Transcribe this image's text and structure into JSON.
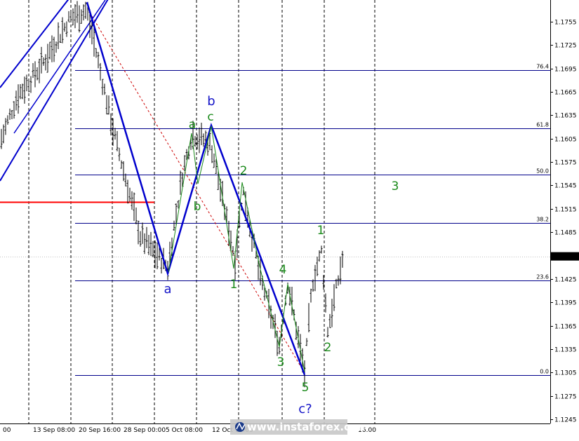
{
  "chart_data": {
    "type": "candlestick",
    "title": "",
    "y_ticks": [
      1.1755,
      1.1725,
      1.1695,
      1.1665,
      1.1635,
      1.1605,
      1.1575,
      1.1545,
      1.1515,
      1.1485,
      1.1454,
      1.1425,
      1.1395,
      1.1365,
      1.1335,
      1.1305,
      1.1275,
      1.1245
    ],
    "y_tick_labels": [
      "1.1755",
      "1.1725",
      "1.1695",
      "1.1665",
      "1.1635",
      "1.1605",
      "1.1575",
      "1.1545",
      "1.1515",
      "1.1485",
      "1.1425",
      "1.1395",
      "1.1365",
      "1.1335",
      "1.1305",
      "1.1275",
      "1.1245"
    ],
    "ylim": [
      1.1232,
      1.1795
    ],
    "current_price": "1.1454",
    "x_labels": [
      "00",
      "13 Sep 08:00",
      "20 Sep 16:00",
      "28 Sep 00:00",
      "5 Oct 08:00",
      "12 Oct 16:00",
      "16:00"
    ],
    "fib_levels": [
      {
        "label": "76.4",
        "price": 1.1693
      },
      {
        "label": "61.8",
        "price": 1.1618
      },
      {
        "label": "50.0",
        "price": 1.1559
      },
      {
        "label": "38.2",
        "price": 1.1497
      },
      {
        "label": "23.6",
        "price": 1.1423
      },
      {
        "label": "0.0",
        "price": 1.1302
      }
    ],
    "support_line_price": 1.1524,
    "wave_labels_green": [
      "a",
      "c",
      "b",
      "2",
      "1",
      "4",
      "3",
      "5",
      "1",
      "2",
      "3"
    ],
    "wave_labels_blue": [
      "b",
      "a",
      "c?"
    ],
    "wave_path_points": [
      {
        "time": "2018-09-21",
        "price": 1.178
      },
      {
        "time": "2018-10-09",
        "price": 1.1432
      },
      {
        "time": "2018-10-15",
        "price": 1.1622
      },
      {
        "time": "2018-10-31",
        "price": 1.1302
      }
    ],
    "grid": "vertical-dashed",
    "colors": {
      "wave_line": "#0000cd",
      "fib_line": "#00008b",
      "support_line": "#ff0000",
      "green_wave": "#1a8a1a",
      "dashed_trend": "#cc0000"
    }
  },
  "watermark": {
    "text": "www.instaforex.com",
    "logo_color": "#1a3a8a",
    "band_color": "#c8c8c8"
  }
}
